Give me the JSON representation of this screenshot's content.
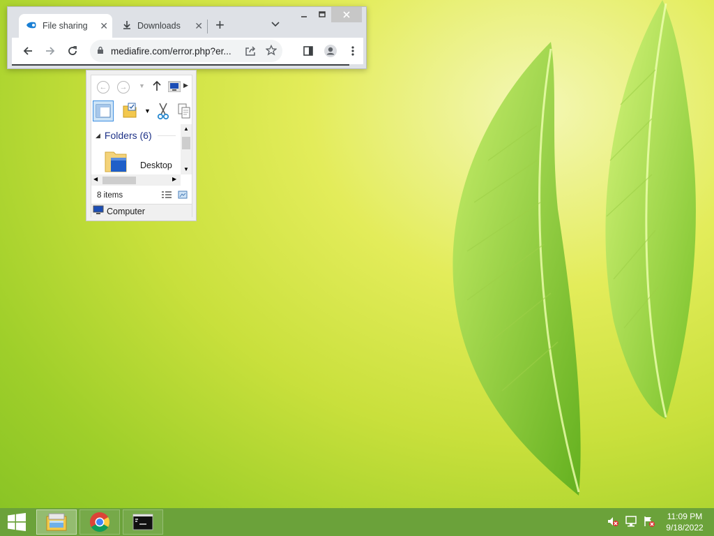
{
  "browser": {
    "tabs": [
      {
        "label": "File sharing a",
        "active": true
      },
      {
        "label": "Downloads",
        "active": false
      }
    ],
    "address": "mediafire.com/error.php?er...",
    "close_symbol": "✕"
  },
  "explorer": {
    "section_header": "Folders (6)",
    "folder_label": "Desktop",
    "status_count": "8 items",
    "footer_label": "Computer"
  },
  "taskbar": {
    "apps": [
      "file-explorer",
      "chrome",
      "command-prompt"
    ],
    "time": "11:09 PM",
    "date": "9/18/2022"
  },
  "colors": {
    "taskbar": "#6ba23a",
    "chrome_frame": "#dee1e6",
    "folder_header": "#1e3287"
  }
}
